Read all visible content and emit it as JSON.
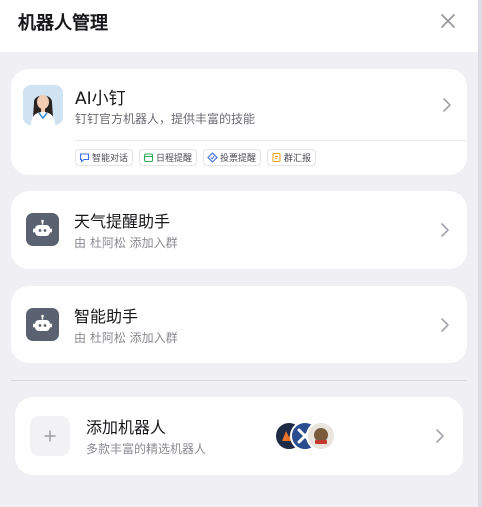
{
  "header": {
    "title": "机器人管理",
    "close_icon": "close-icon"
  },
  "ai_card": {
    "name": "AI小钉",
    "description": "钉钉官方机器人，提供丰富的技能",
    "skills": [
      {
        "label": "智能对话",
        "icon": "chat-icon",
        "color": "#3d6fe0"
      },
      {
        "label": "日程提醒",
        "icon": "calendar-icon",
        "color": "#2bab5c"
      },
      {
        "label": "投票提醒",
        "icon": "vote-icon",
        "color": "#3d6fe0"
      },
      {
        "label": "群汇报",
        "icon": "report-icon",
        "color": "#f0a41e"
      }
    ]
  },
  "robots": [
    {
      "name": "天气提醒助手",
      "added_by": "由 杜阿松 添加入群",
      "icon": "robot-icon"
    },
    {
      "name": "智能助手",
      "added_by": "由 杜阿松 添加入群",
      "icon": "robot-icon"
    }
  ],
  "add_robot": {
    "title": "添加机器人",
    "subtitle": "多款丰富的精选机器人",
    "icon": "plus-icon"
  },
  "colors": {
    "page_bg": "#efeff4",
    "card_bg": "#ffffff",
    "robot_avatar": "#5a6170",
    "secondary_text": "#8a8a93"
  }
}
